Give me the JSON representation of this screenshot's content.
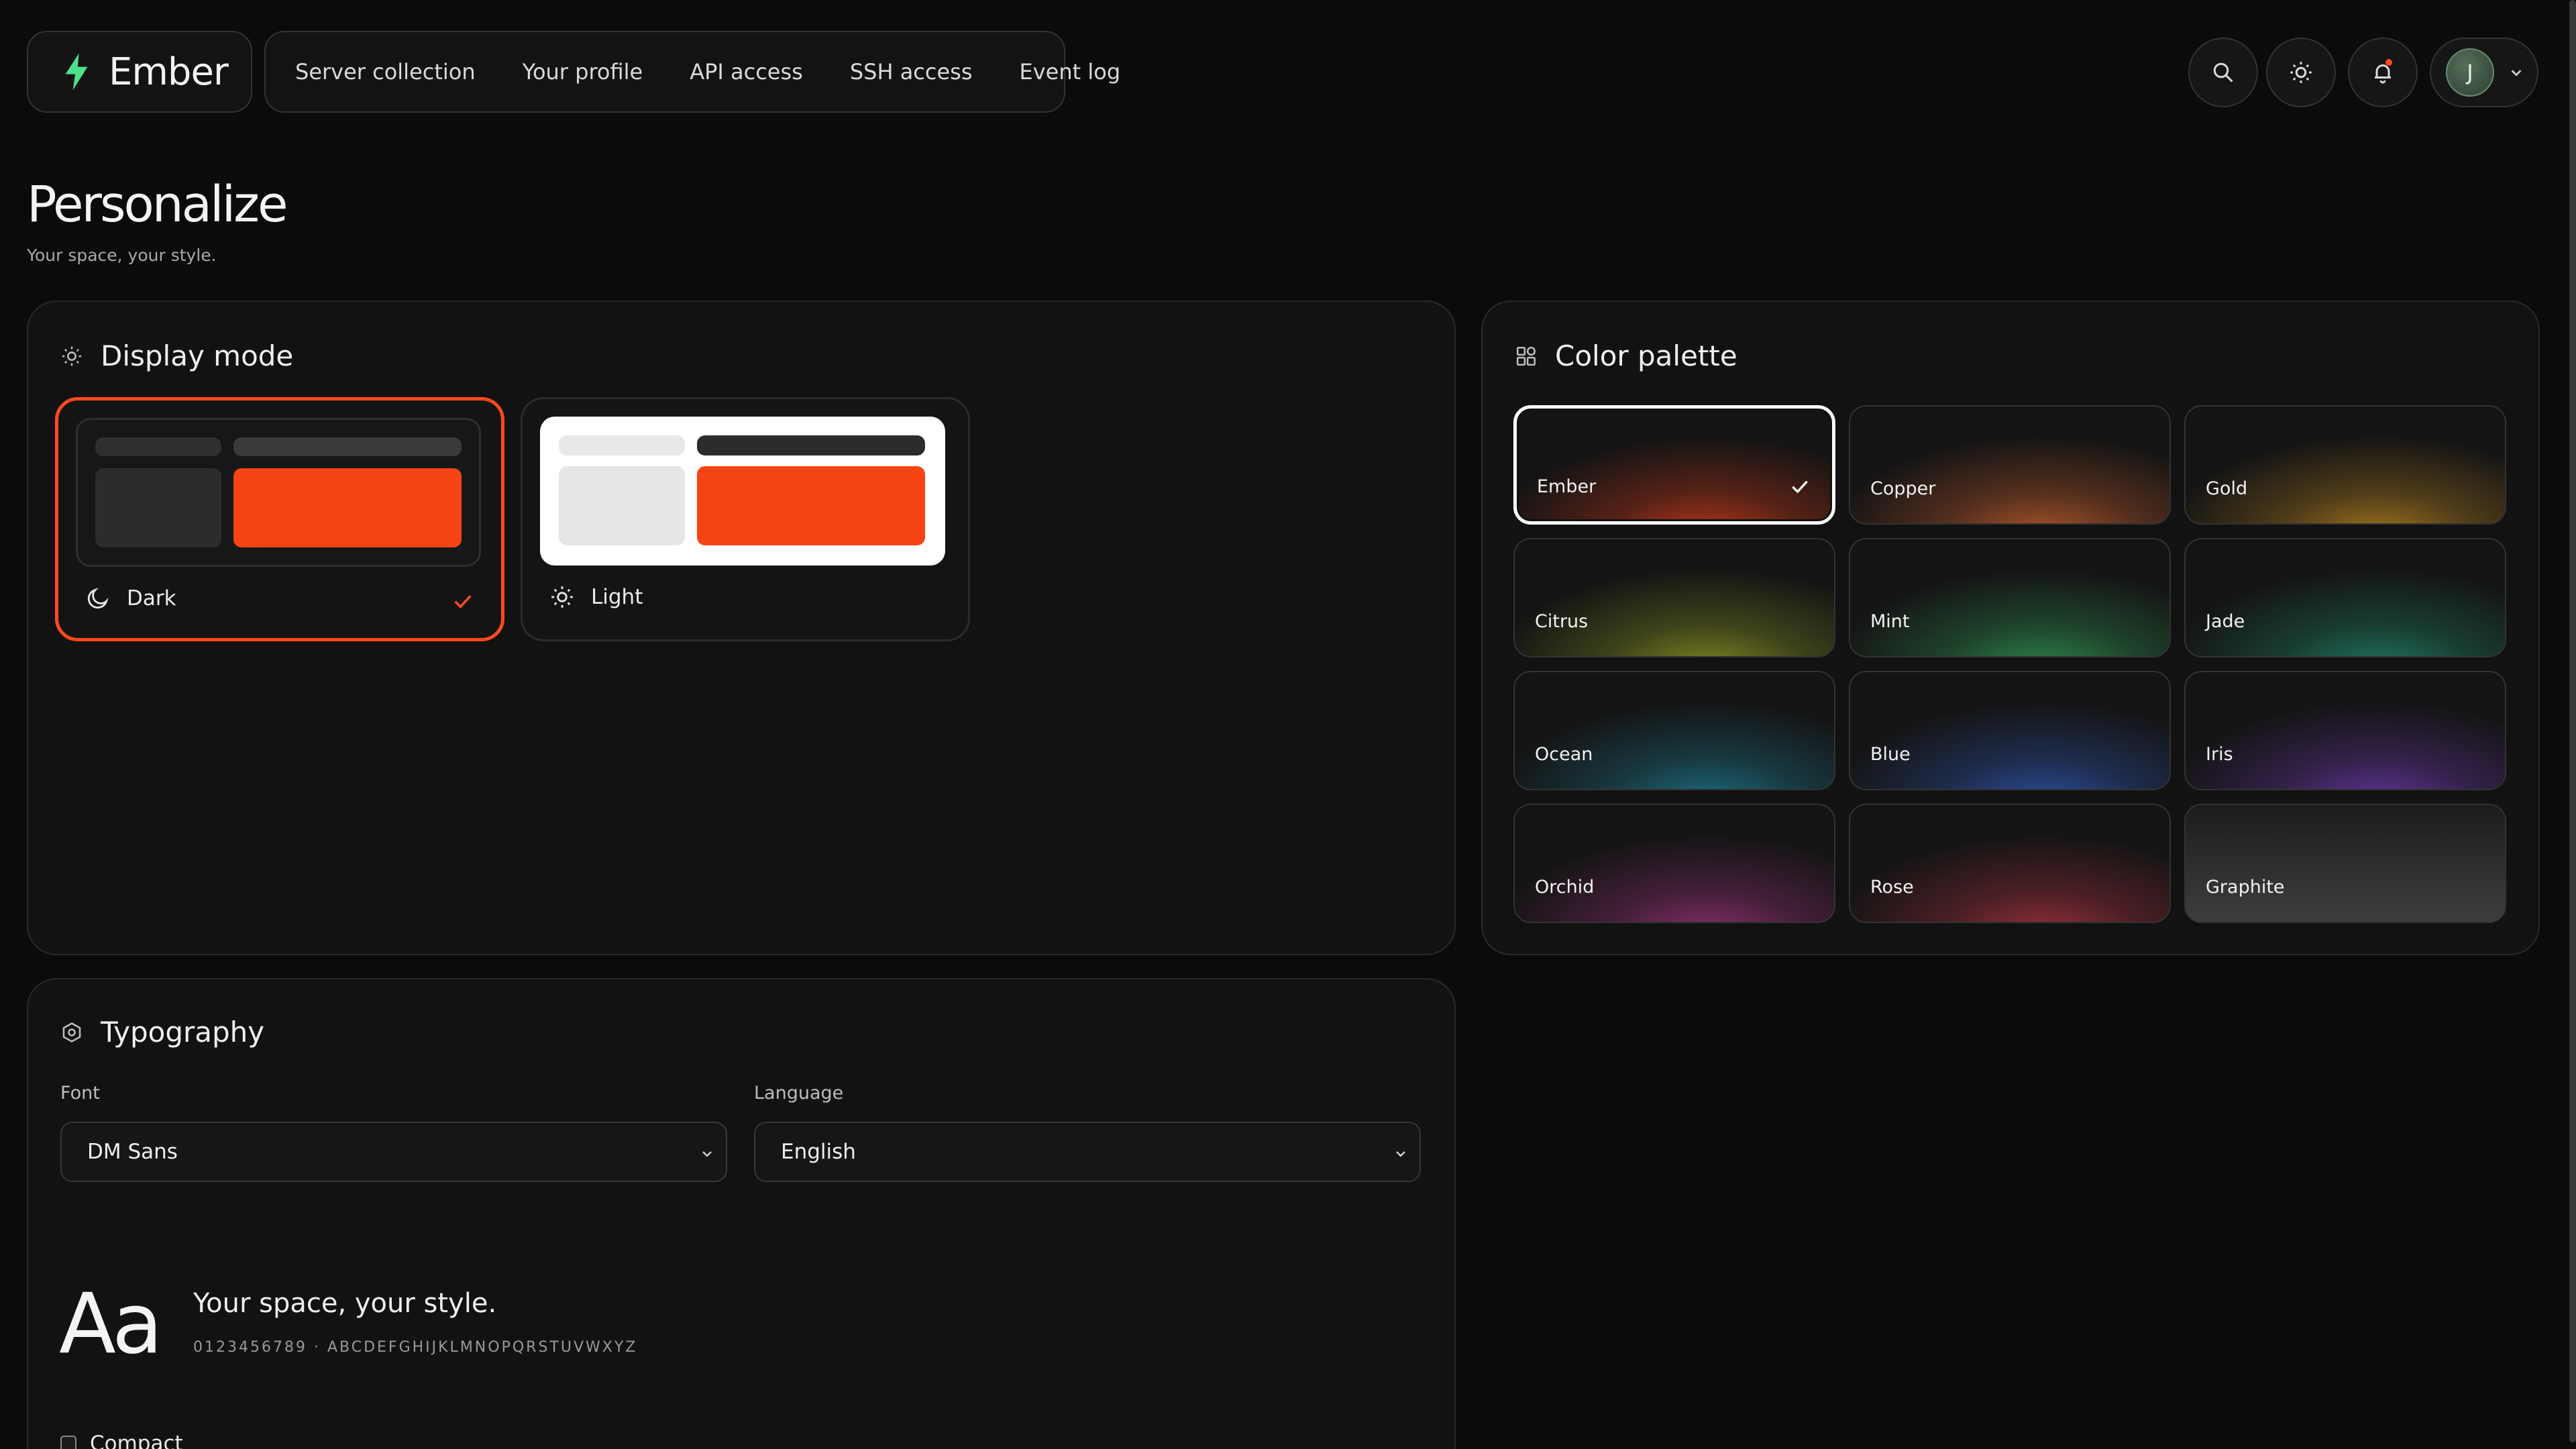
{
  "brand": {
    "name": "Ember",
    "accent": "#4fe08a"
  },
  "nav": {
    "items": [
      {
        "label": "Server collection"
      },
      {
        "label": "Your profile"
      },
      {
        "label": "API access"
      },
      {
        "label": "SSH access"
      },
      {
        "label": "Event log"
      }
    ]
  },
  "header": {
    "actions": [
      "search-icon",
      "sun-icon",
      "bell-icon"
    ],
    "user_initial": "J"
  },
  "page": {
    "title": "Personalize",
    "subtitle": "Your space, your style."
  },
  "display_mode": {
    "title": "Display mode",
    "options": [
      {
        "label": "Dark",
        "selected": true
      },
      {
        "label": "Light",
        "selected": false
      }
    ],
    "accent": "#ff4a1c"
  },
  "palette": {
    "title": "Color palette",
    "selected": "Ember",
    "swatches": [
      {
        "label": "Ember",
        "color": "#b8361a"
      },
      {
        "label": "Copper",
        "color": "#b4572b"
      },
      {
        "label": "Gold",
        "color": "#a7771f"
      },
      {
        "label": "Citrus",
        "color": "#7f8a22"
      },
      {
        "label": "Mint",
        "color": "#2e8a4e"
      },
      {
        "label": "Jade",
        "color": "#1f7a60"
      },
      {
        "label": "Ocean",
        "color": "#1d6e82"
      },
      {
        "label": "Blue",
        "color": "#2c4f9e"
      },
      {
        "label": "Iris",
        "color": "#61359a"
      },
      {
        "label": "Orchid",
        "color": "#8a2f6e"
      },
      {
        "label": "Rose",
        "color": "#9b2f3c"
      },
      {
        "label": "Graphite",
        "color": "#5a5a5a"
      }
    ]
  },
  "typography": {
    "title": "Typography",
    "font_label": "Font",
    "font_value": "DM Sans",
    "language_label": "Language",
    "language_value": "English",
    "sample_glyph": "Aa",
    "sample_text": "Your space, your style.",
    "sample_chars": "0123456789 · ABCDEFGHIJKLMNOPQRSTUVWXYZ",
    "compact_label": "Compact"
  }
}
